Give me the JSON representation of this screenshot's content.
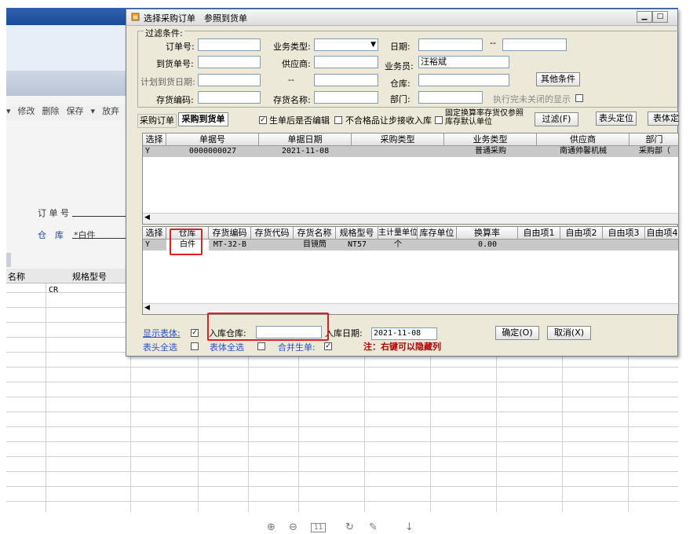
{
  "background": {
    "toolbar": [
      "▾",
      "修改",
      "删除",
      "保存",
      "▾",
      "放弃"
    ],
    "order_no_label": "订 单 号",
    "warehouse_label": "仓　库",
    "warehouse_value": "*白件",
    "grid_headers": [
      "名称",
      "规格型号"
    ],
    "grid_cell": "CR"
  },
  "dialog": {
    "title": "选择采购订单　参照到货单",
    "filter_group": "过滤条件:",
    "filters": {
      "order_no": "订单号:",
      "biz_type": "业务类型:",
      "date": "日期:",
      "date_sep": "--",
      "arrival_no": "到货单号:",
      "supplier": "供应商:",
      "buyer": "业务员:",
      "buyer_value": "汪裕斌",
      "plan_date": "计划到货日期:",
      "plan_sep": "--",
      "warehouse": "仓库:",
      "inv_code": "存货编码:",
      "inv_name": "存货名称:",
      "dept": "部门:",
      "other_btn": "其他条件",
      "closed_label": "执行完未关闭的显示"
    },
    "tabs": [
      "采购订单",
      "采购到货单"
    ],
    "options": {
      "edit_after": "生单后是否编辑",
      "unqualified": "不合格品让步接收入库",
      "fixed_rate": "固定换算率存货仅参照库存默认单位",
      "filter_btn": "过滤(F)",
      "head_locate_btn": "表头定位",
      "body_locate_btn": "表体定"
    },
    "header_grid": {
      "columns": [
        "选择",
        "单据号",
        "单据日期",
        "采购类型",
        "业务类型",
        "供应商",
        "部门"
      ],
      "rows": [
        [
          "Y",
          "0000000027",
          "2021-11-08",
          "",
          "普通采购",
          "南通帅馨机械",
          "采购部（"
        ]
      ]
    },
    "body_grid": {
      "columns": [
        "选择",
        "仓库",
        "存货编码",
        "存货代码",
        "存货名称",
        "规格型号",
        "主计量单位",
        "库存单位",
        "换算率",
        "自由项1",
        "自由项2",
        "自由项3",
        "自由项4"
      ],
      "rows": [
        [
          "Y",
          "白件",
          "MT-32-B",
          "",
          "目镜筒",
          "NT57",
          "个",
          "",
          "0.00",
          "",
          "",
          "",
          ""
        ]
      ]
    },
    "bottom": {
      "show_body": "显示表体:",
      "in_warehouse": "入库仓库:",
      "in_date": "入库日期:",
      "in_date_value": "2021-11-08",
      "ok_btn": "确定(O)",
      "cancel_btn": "取消(X)",
      "head_all": "表头全选",
      "body_all": "表体全选",
      "merge": "合并生单:",
      "note": "注：右键可以隐藏列"
    }
  },
  "viewer": {
    "icons": [
      "zoom-in",
      "zoom-out",
      "fit-page",
      "rotate",
      "pen",
      "download"
    ],
    "page_badge": "11"
  },
  "colors": {
    "accent_red": "#e02020",
    "dialog_bg": "#ece9d8",
    "link_blue": "#2a4fd0"
  }
}
